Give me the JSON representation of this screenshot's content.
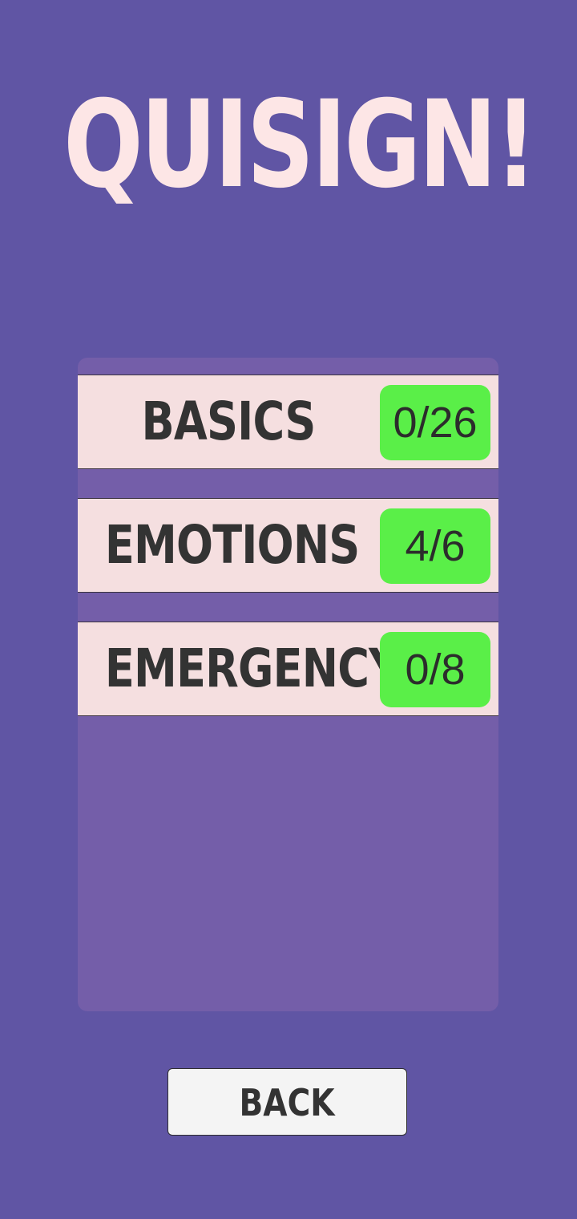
{
  "app": {
    "title": "QUISIGN!"
  },
  "categories": [
    {
      "label": "BASICS",
      "score": "0/26"
    },
    {
      "label": "EMOTIONS",
      "score": "4/6"
    },
    {
      "label": "EMERGENCY",
      "score": "0/8"
    }
  ],
  "back_button": {
    "label": "BACK"
  },
  "colors": {
    "background": "#6055a4",
    "panel": "#745ea9",
    "row": "#f5dfe0",
    "badge": "#5aef48",
    "title": "#fde6e6"
  }
}
